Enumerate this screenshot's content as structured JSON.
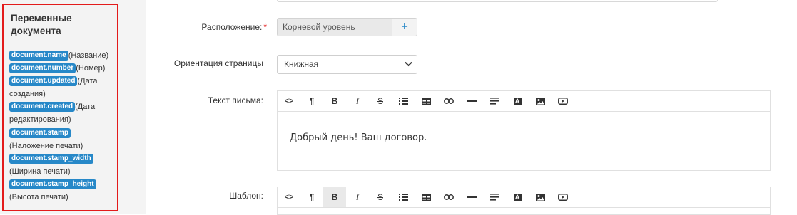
{
  "sidebar": {
    "title": "Переменные документа",
    "variables": [
      {
        "tag": "document.name",
        "desc": "(Название)"
      },
      {
        "tag": "document.number",
        "desc": "(Номер)"
      },
      {
        "tag": "document.updated",
        "desc": "(Дата создания)"
      },
      {
        "tag": "document.created",
        "desc": "(Дата редактирования)"
      },
      {
        "tag": "document.stamp",
        "desc": "(Наложение печати)"
      },
      {
        "tag": "document.stamp_width",
        "desc": "(Ширина печати)"
      },
      {
        "tag": "document.stamp_height",
        "desc": "(Высота печати)"
      }
    ]
  },
  "form": {
    "location": {
      "label": "Расположение:",
      "required_mark": "*",
      "value": "Корневой уровень",
      "add_label": "+"
    },
    "orientation": {
      "label": "Ориентация страницы",
      "value": "Книжная"
    },
    "letter_text": {
      "label": "Текст письма:",
      "content": "Добрый день! Ваш договор."
    },
    "template": {
      "label": "Шаблон:"
    }
  },
  "toolbar": {
    "buttons": [
      {
        "name": "code-view",
        "icon": "code-icon",
        "label": "<>"
      },
      {
        "name": "paragraph",
        "icon": "paragraph-icon",
        "label": "¶"
      },
      {
        "name": "bold",
        "icon": "bold-icon",
        "label": "B"
      },
      {
        "name": "italic",
        "icon": "italic-icon",
        "label": "I"
      },
      {
        "name": "strikethrough",
        "icon": "strikethrough-icon",
        "label": "S"
      },
      {
        "name": "unordered-list",
        "icon": "list-icon"
      },
      {
        "name": "table",
        "icon": "table-icon"
      },
      {
        "name": "link",
        "icon": "link-icon"
      },
      {
        "name": "horizontal-rule",
        "icon": "hr-icon"
      },
      {
        "name": "align",
        "icon": "align-icon"
      },
      {
        "name": "font-color",
        "icon": "text-color-icon",
        "label": "A"
      },
      {
        "name": "image",
        "icon": "image-icon"
      },
      {
        "name": "video",
        "icon": "video-icon"
      }
    ]
  },
  "colors": {
    "accent": "#2788c8",
    "highlight_border": "#e31b1b",
    "required": "#e31b1b"
  }
}
